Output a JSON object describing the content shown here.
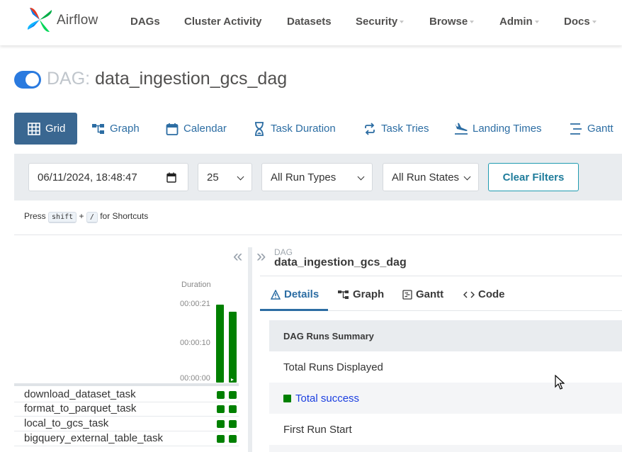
{
  "navbar": {
    "brand": "Airflow",
    "items": [
      {
        "label": "DAGs",
        "dropdown": false
      },
      {
        "label": "Cluster Activity",
        "dropdown": false
      },
      {
        "label": "Datasets",
        "dropdown": false
      },
      {
        "label": "Security",
        "dropdown": true
      },
      {
        "label": "Browse",
        "dropdown": true
      },
      {
        "label": "Admin",
        "dropdown": true
      },
      {
        "label": "Docs",
        "dropdown": true
      }
    ]
  },
  "header": {
    "dag_prefix": "DAG:",
    "dag_id": "data_ingestion_gcs_dag",
    "paused": false
  },
  "view_tabs": [
    {
      "label": "Grid",
      "icon": "grid-icon",
      "active": true
    },
    {
      "label": "Graph",
      "icon": "graph-icon"
    },
    {
      "label": "Calendar",
      "icon": "calendar-icon"
    },
    {
      "label": "Task Duration",
      "icon": "hourglass-icon"
    },
    {
      "label": "Task Tries",
      "icon": "retry-icon"
    },
    {
      "label": "Landing Times",
      "icon": "plane-landing-icon"
    },
    {
      "label": "Gantt",
      "icon": "gantt-icon"
    }
  ],
  "filters": {
    "datetime_value": "06/11/2024, 18:48:47",
    "num_runs": "25",
    "run_type": "All Run Types",
    "run_state": "All Run States",
    "clear_label": "Clear Filters"
  },
  "shortcuts": {
    "press": "Press",
    "key1": "shift",
    "plus": "+",
    "key2": "/",
    "suffix": "for Shortcuts"
  },
  "grid": {
    "duration_label": "Duration",
    "ticks": [
      "00:00:21",
      "00:00:10",
      "00:00:00"
    ],
    "runs": [
      {
        "duration_fraction": 1.0,
        "state": "success"
      },
      {
        "duration_fraction": 0.91,
        "state": "success"
      }
    ],
    "tasks": [
      {
        "name": "download_dataset_task",
        "states": [
          "success",
          "success"
        ]
      },
      {
        "name": "format_to_parquet_task",
        "states": [
          "success",
          "success"
        ]
      },
      {
        "name": "local_to_gcs_task",
        "states": [
          "success",
          "success"
        ]
      },
      {
        "name": "bigquery_external_table_task",
        "states": [
          "success",
          "success"
        ]
      }
    ],
    "success_color": "#008000"
  },
  "details": {
    "label": "DAG",
    "dag_id": "data_ingestion_gcs_dag",
    "tabs": [
      {
        "label": "Details",
        "icon": "warning-triangle-icon",
        "active": true
      },
      {
        "label": "Graph",
        "icon": "graph-icon"
      },
      {
        "label": "Gantt",
        "icon": "gantt-icon"
      },
      {
        "label": "Code",
        "icon": "code-icon"
      }
    ],
    "table": {
      "header": "DAG Runs Summary",
      "rows": [
        "Total Runs Displayed",
        "Total success",
        "First Run Start"
      ]
    }
  }
}
